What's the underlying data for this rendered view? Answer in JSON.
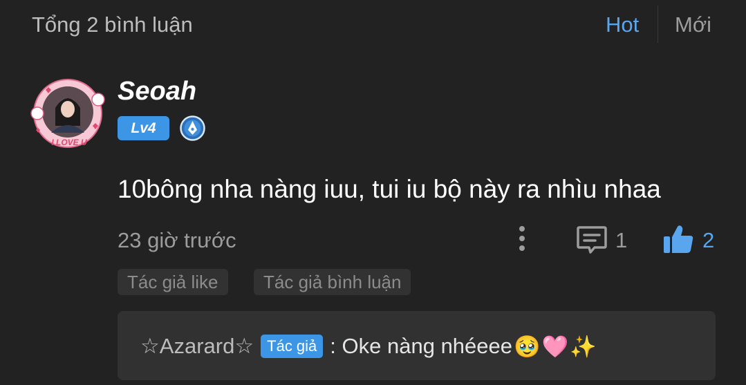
{
  "header": {
    "total": "Tổng 2 bình luận",
    "sort_hot": "Hot",
    "sort_new": "Mới"
  },
  "comment": {
    "username": "Seoah",
    "level": "Lv4",
    "content": "10bông nha nàng iuu, tui iu bộ này ra nhìu nhaa",
    "time": "23 giờ trước",
    "comment_count": "1",
    "like_count": "2",
    "tags": [
      "Tác giả like",
      "Tác giả bình luận"
    ],
    "avatar_frame_text": "I LOVE U",
    "icons": {
      "badge": "pen-nib-badge-icon",
      "more": "more-vertical-icon",
      "comment": "comment-icon",
      "like": "thumbs-up-icon"
    }
  },
  "reply": {
    "name": "☆Azarard☆",
    "author_tag": "Tác giả",
    "text": ": Oke nàng nhéeee",
    "emojis": [
      "🥹",
      "🩷",
      "✨"
    ]
  },
  "colors": {
    "background": "#222222",
    "accent": "#5aa6ee",
    "level_bg": "#3d96e5",
    "reply_bg": "#313131",
    "tag_bg": "#323232"
  }
}
